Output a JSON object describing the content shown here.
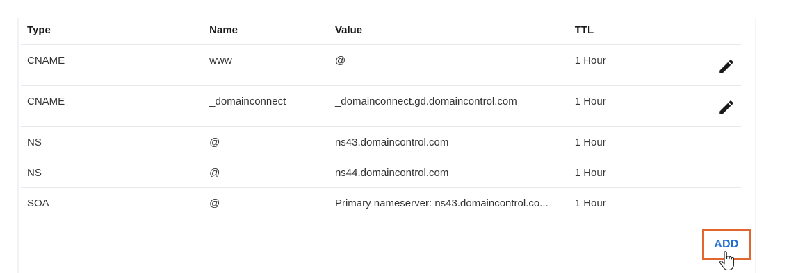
{
  "table": {
    "headers": [
      "Type",
      "Name",
      "Value",
      "TTL"
    ],
    "rows": [
      {
        "type": "CNAME",
        "name": "www",
        "value": "@",
        "ttl": "1 Hour",
        "editable": true
      },
      {
        "type": "CNAME",
        "name": "_domainconnect",
        "value": "_domainconnect.gd.domaincontrol.com",
        "ttl": "1 Hour",
        "editable": true
      },
      {
        "type": "NS",
        "name": "@",
        "value": "ns43.domaincontrol.com",
        "ttl": "1 Hour",
        "editable": false
      },
      {
        "type": "NS",
        "name": "@",
        "value": "ns44.domaincontrol.com",
        "ttl": "1 Hour",
        "editable": false
      },
      {
        "type": "SOA",
        "name": "@",
        "value": "Primary nameserver: ns43.domaincontrol.co...",
        "ttl": "1 Hour",
        "editable": false
      }
    ]
  },
  "add_button": {
    "label": "ADD"
  },
  "icons": {
    "edit": "pencil-icon",
    "cursor": "hand-pointer-icon"
  },
  "colors": {
    "accent": "#1f6fd1",
    "highlight": "#e2662f",
    "divider": "#e6e8eb"
  }
}
